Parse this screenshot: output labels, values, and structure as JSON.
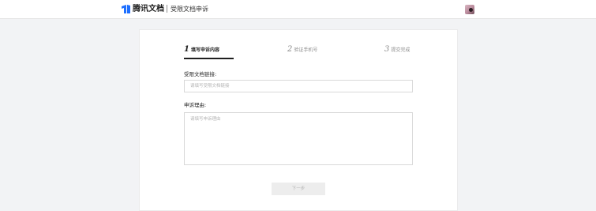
{
  "header": {
    "brand": "腾讯文档",
    "subtitle": "受限文档申诉",
    "logo_icon": "tencent-docs-logo-icon",
    "avatar_icon": "user-avatar"
  },
  "steps": [
    {
      "number": "1",
      "label": "填写申诉内容",
      "active": true
    },
    {
      "number": "2",
      "label": "验证手机号",
      "active": false
    },
    {
      "number": "3",
      "label": "提交完成",
      "active": false
    }
  ],
  "form": {
    "link_label": "受限文档链接:",
    "link_placeholder": "请填写受限文档链接",
    "reason_label": "申诉理由:",
    "reason_placeholder": "请填写申诉理由",
    "next_label": "下一步"
  },
  "colors": {
    "accent": "#1f1f1f",
    "logo_blue": "#1e6fff",
    "background": "#f2f3f5"
  }
}
